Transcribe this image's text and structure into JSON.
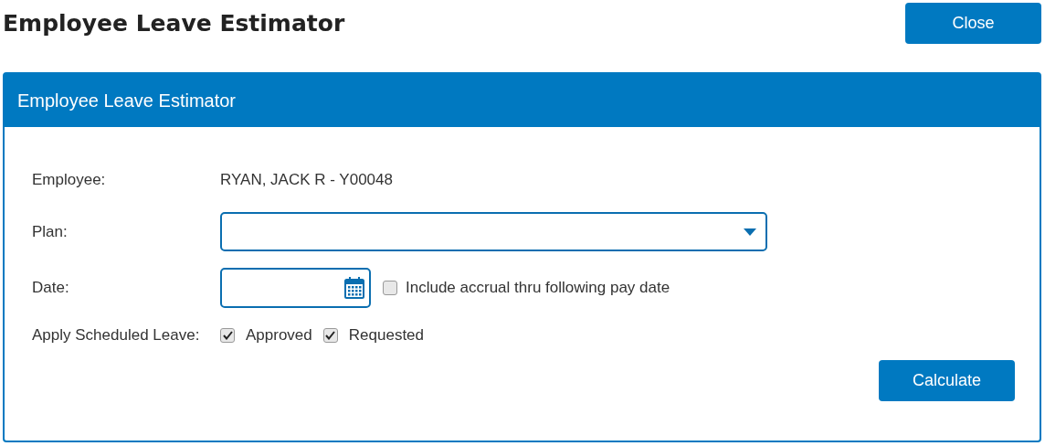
{
  "page_title": "Employee Leave Estimator",
  "close_button": "Close",
  "panel": {
    "title": "Employee Leave Estimator",
    "employee": {
      "label": "Employee:",
      "value": "RYAN, JACK R - Y00048"
    },
    "plan": {
      "label": "Plan:"
    },
    "date": {
      "label": "Date:",
      "include_accrual": {
        "label": "Include accrual thru following pay date",
        "checked": false
      }
    },
    "scheduled_leave": {
      "label": "Apply Scheduled Leave:",
      "options": [
        {
          "label": "Approved",
          "checked": true
        },
        {
          "label": "Requested",
          "checked": true
        }
      ]
    },
    "calculate_button": "Calculate"
  }
}
